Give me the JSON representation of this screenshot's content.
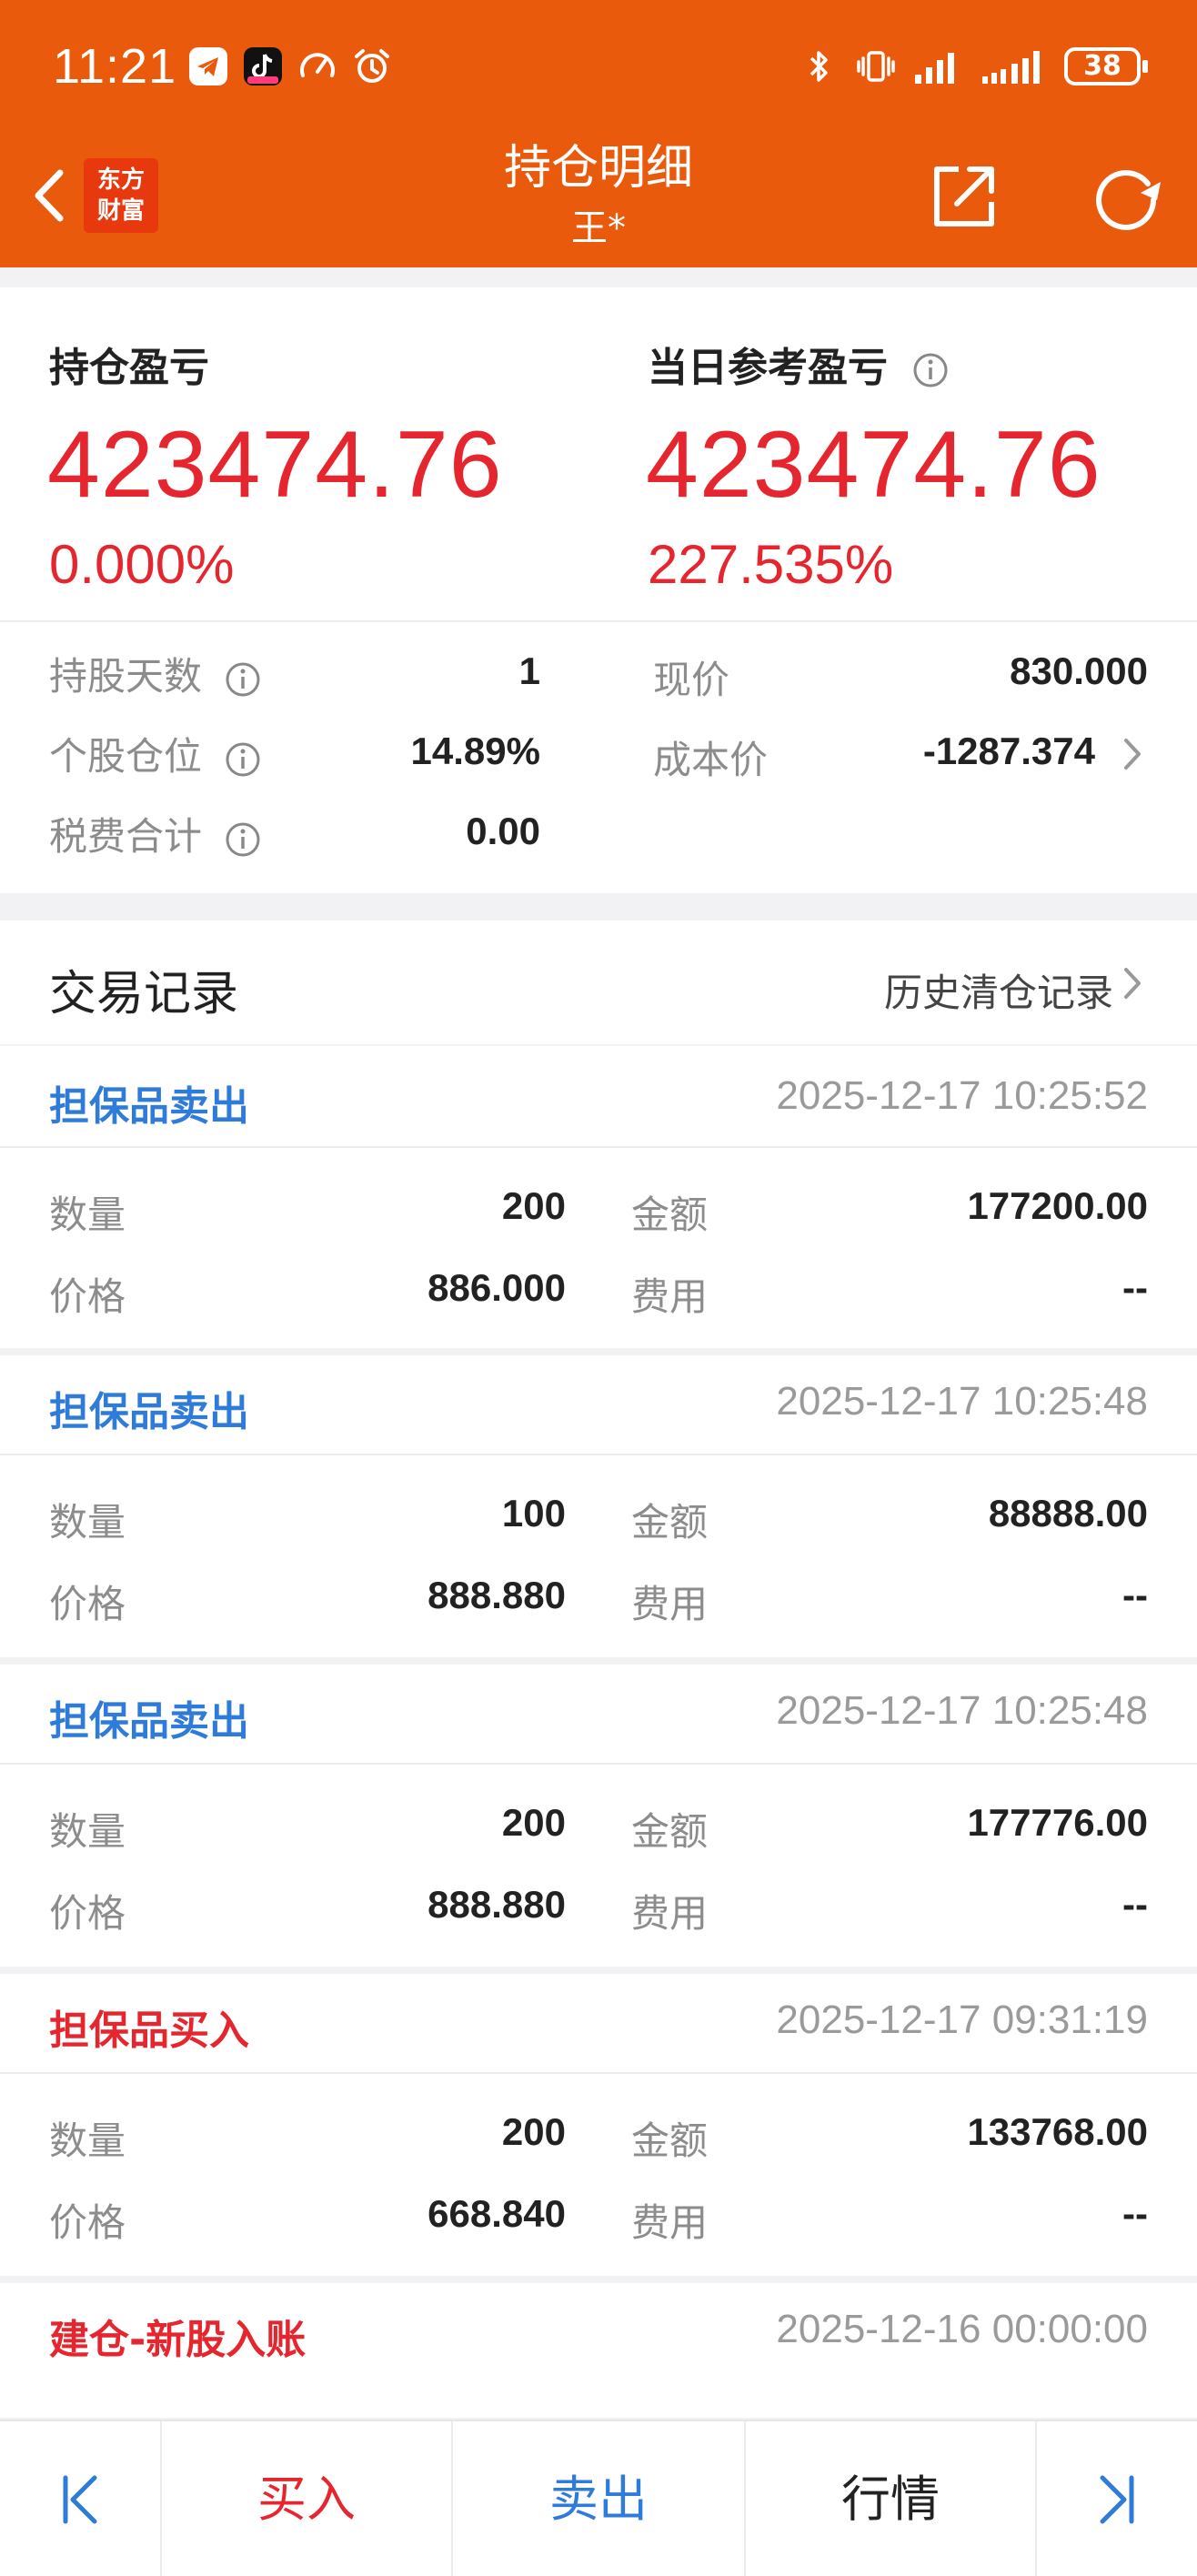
{
  "status_bar": {
    "time": "11:21",
    "battery": "38",
    "icons": [
      "telegram-icon",
      "douyin-icon",
      "speedometer-icon",
      "alarm-icon",
      "bluetooth-icon",
      "vibrate-icon",
      "signal-icon",
      "signal-4g-icon"
    ]
  },
  "header": {
    "title": "持仓明细",
    "subtitle": "王*",
    "logo": "东方财富",
    "logo_line1": "东方",
    "logo_line2": "财富",
    "back_icon": "back-chevron-icon",
    "share_icon": "share-icon",
    "refresh_icon": "refresh-icon",
    "bg_color": "#ea5a0c"
  },
  "summary": {
    "position_pl": {
      "label": "持仓盈亏",
      "value": "423474.76",
      "pct": "0.000%"
    },
    "daily_pl": {
      "label": "当日参考盈亏",
      "value": "423474.76",
      "pct": "227.535%"
    },
    "stats_left": [
      {
        "label": "持股天数",
        "value": "1"
      },
      {
        "label": "个股仓位",
        "value": "14.89%"
      },
      {
        "label": "税费合计",
        "value": "0.00"
      }
    ],
    "stats_right": [
      {
        "label": "现价",
        "value": "830.000"
      },
      {
        "label": "成本价",
        "value": "-1287.374"
      }
    ],
    "red_color": "#e5262e"
  },
  "trades_section": {
    "title": "交易记录",
    "history_link": "历史清仓记录",
    "labels": {
      "qty": "数量",
      "amount": "金额",
      "price": "价格",
      "fee": "费用"
    },
    "records": [
      {
        "type": "担保品卖出",
        "side": "sell",
        "time": "2025-12-17 10:25:52",
        "qty": "200",
        "amount": "177200.00",
        "price": "886.000",
        "fee": "--"
      },
      {
        "type": "担保品卖出",
        "side": "sell",
        "time": "2025-12-17 10:25:48",
        "qty": "100",
        "amount": "88888.00",
        "price": "888.880",
        "fee": "--"
      },
      {
        "type": "担保品卖出",
        "side": "sell",
        "time": "2025-12-17 10:25:48",
        "qty": "200",
        "amount": "177776.00",
        "price": "888.880",
        "fee": "--"
      },
      {
        "type": "担保品买入",
        "side": "buy",
        "time": "2025-12-17 09:31:19",
        "qty": "200",
        "amount": "133768.00",
        "price": "668.840",
        "fee": "--"
      },
      {
        "type": "建仓-新股入账",
        "side": "buy",
        "time": "2025-12-16 00:00:00"
      }
    ],
    "sell_color": "#2f7bd9",
    "buy_color": "#e5262e"
  },
  "bottom_bar": {
    "first_icon": "skip-first-icon",
    "buy": "买入",
    "sell": "卖出",
    "quote": "行情",
    "last_icon": "skip-last-icon"
  }
}
